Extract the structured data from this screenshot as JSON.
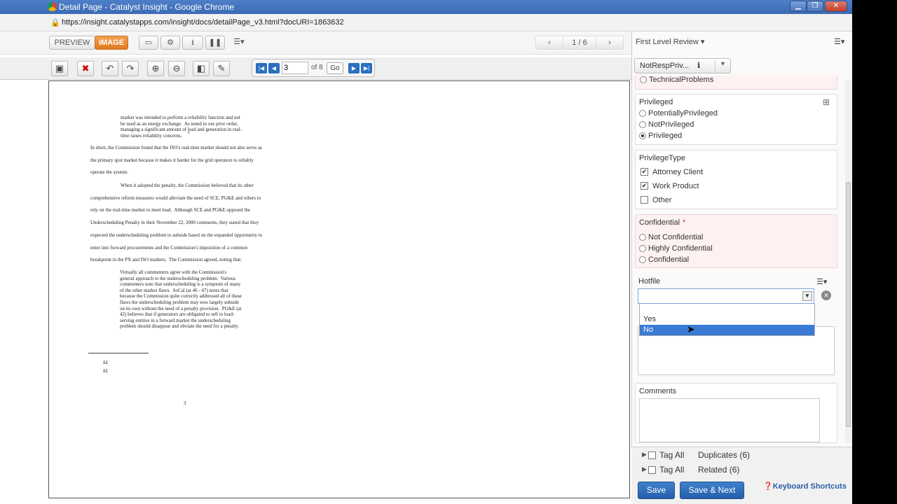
{
  "window": {
    "title": "Detail Page - Catalyst Insight - Google Chrome",
    "minimize": "▁",
    "maximize": "❐",
    "close": "✕"
  },
  "address": {
    "url": "https://insight.catalystapps.com/insight/docs/detailPage_v3.html?docURI=1863632"
  },
  "toolbar": {
    "preview": "PREVIEW",
    "image": "IMAGE",
    "page_indicator": "1 / 6",
    "prev": "‹",
    "next": "›"
  },
  "image_toolbar": {
    "page_input": "3",
    "of_label": "of 8",
    "go_label": "Go"
  },
  "review": {
    "header": "First Level Review ▾",
    "selector": "NotRespPriv...",
    "info": "ℹ"
  },
  "fields": {
    "technical": "TechnicalProblems",
    "privileged": {
      "label": "Privileged",
      "options": [
        "PotentiallyPrivileged",
        "NotPrivileged",
        "Privileged"
      ],
      "selected": 2
    },
    "privilege_type": {
      "label": "PrivilegeType",
      "options": [
        "Attorney Client",
        "Work Product",
        "Other"
      ],
      "checked": [
        true,
        true,
        false
      ]
    },
    "confidential": {
      "label": "Confidential",
      "required": "*",
      "options": [
        "Not Confidential",
        "Highly Confidential",
        "Confidential"
      ]
    },
    "hotfile": {
      "label": "Hotfile",
      "dropdown_options": [
        "Yes",
        "No"
      ],
      "highlighted": "No"
    },
    "comments": {
      "label": "Comments"
    }
  },
  "bottom": {
    "tag_all": "Tag All",
    "duplicates": "Duplicates (6)",
    "related": "Related (6)",
    "save": "Save",
    "save_next": "Save & Next",
    "shortcuts": "Keyboard Shortcuts"
  },
  "document": {
    "block1": "market was intended to perform a reliability function and not\nbe used as an energy exchange.  As noted in our prior order,\nmanaging a significant amount of load and generation in real-\ntime raises reliability concerns.",
    "para1": [
      "In short, the Commission found that the ISO's real-time market should not also serve as",
      "the primary spot market because it makes it harder for the grid operators to reliably",
      "operate the system."
    ],
    "para2": [
      "When it adopted the penalty, the Commission believed that its other",
      "comprehensive reform measures would alleviate the need of SCE, PG&E and others to",
      "rely on the real-time market to meet load.  Although SCE and PG&E opposed the",
      "Underscheduling Penalty in their November 22, 2000 comments, they stated that they",
      "expected the underscheduling problem to subside based on the expanded opportunity to",
      "enter into forward procurements and the Commission's imposition of a common",
      "breakpoint in the PX and ISO markets.  The Commission agreed, noting that:"
    ],
    "block2": "Virtually all commenters agree with the Commission's\ngeneral approach to the underscheduling problem.  Various\ncommenters note that underscheduling is a symptom of many\nof the other market flaws.  SoCal (at 46 - 47) notes that\nbecause the Commission quite correctly addressed all of these\nflaws the underscheduling problem may now largely subside\non its own without the need of a penalty provision.  PG&E (at\n42) believes that if generators are obligated to sell to load-\nserving entities in a forward market the underscheduling\nproblem should disappear and obviate the need for a penalty.",
    "footnotes": [
      "Id.",
      "Id."
    ],
    "page_number": "3"
  }
}
